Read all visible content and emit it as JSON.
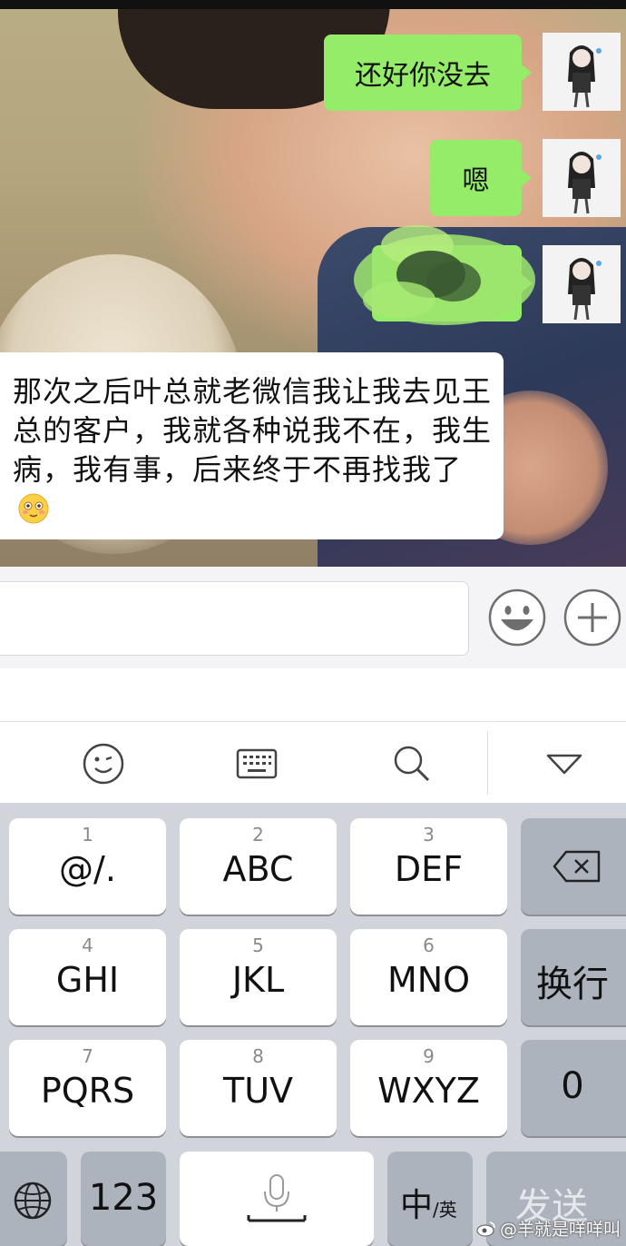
{
  "messages": {
    "out1": "还好你没去",
    "out2": "嗯",
    "in1": "那次之后叶总就老微信我让我去见王总的客户，我就各种说我不在，我生病，我有事，后来终于不再找我了"
  },
  "keyboard": {
    "row1": [
      {
        "num": "1",
        "label": "@/."
      },
      {
        "num": "2",
        "label": "ABC"
      },
      {
        "num": "3",
        "label": "DEF"
      }
    ],
    "row2": [
      {
        "num": "4",
        "label": "GHI"
      },
      {
        "num": "5",
        "label": "JKL"
      },
      {
        "num": "6",
        "label": "MNO"
      }
    ],
    "row3": [
      {
        "num": "7",
        "label": "PQRS"
      },
      {
        "num": "8",
        "label": "TUV"
      },
      {
        "num": "9",
        "label": "WXYZ"
      }
    ],
    "enter_label": "换行",
    "zero_label": "0",
    "num_switch": "123",
    "lang_main": "中",
    "lang_sub": "/英",
    "send_label": "发送"
  },
  "watermark": "@羊就是咩咩叫",
  "icons": {
    "emoji": "smiley-icon",
    "plus": "plus-icon",
    "wink": "wink-icon",
    "keyboard": "keyboard-icon",
    "search": "search-icon",
    "collapse": "triangle-down-icon",
    "backspace": "backspace-icon",
    "globe": "globe-icon",
    "mic": "microphone-icon"
  },
  "colors": {
    "bubble_out": "#95ec69",
    "bubble_in": "#ffffff",
    "key": "#ffffff",
    "key_dark": "#adb3bd"
  }
}
